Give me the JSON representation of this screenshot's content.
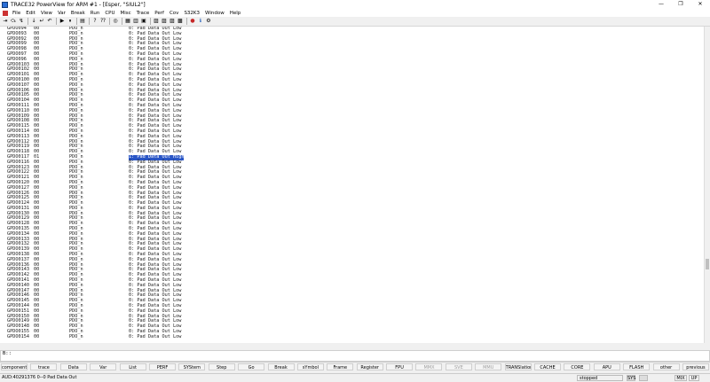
{
  "window": {
    "title": "TRACE32 PowerView for ARM #1 - [Esper, \"SIUL2\"]",
    "controls": [
      "—",
      "❐",
      "✕"
    ]
  },
  "menubar": {
    "items": [
      "File",
      "Edit",
      "View",
      "Var",
      "Break",
      "Run",
      "CPU",
      "Misc",
      "Trace",
      "Perf",
      "Cov",
      "S32K3",
      "Window",
      "Help"
    ]
  },
  "toolbar": {
    "icons": [
      {
        "name": "step-into-icon",
        "glyph": "⇥"
      },
      {
        "name": "step-over-icon",
        "glyph": "⤼"
      },
      {
        "name": "step-asm-icon",
        "glyph": "↯"
      },
      {
        "name": "sep"
      },
      {
        "name": "down-icon",
        "glyph": "↓"
      },
      {
        "name": "return-icon",
        "glyph": "↵"
      },
      {
        "name": "undo-icon",
        "glyph": "↶"
      },
      {
        "name": "sep"
      },
      {
        "name": "go-icon",
        "glyph": "▶"
      },
      {
        "name": "break-icon",
        "glyph": "⏸"
      },
      {
        "name": "sep"
      },
      {
        "name": "view-icon",
        "glyph": "▤"
      },
      {
        "name": "sep"
      },
      {
        "name": "help-icon",
        "glyph": "?"
      },
      {
        "name": "context-help-icon",
        "glyph": "⁇"
      },
      {
        "name": "sep"
      },
      {
        "name": "target-icon",
        "glyph": "◎"
      },
      {
        "name": "sep"
      },
      {
        "name": "list-icon",
        "glyph": "▦"
      },
      {
        "name": "dump-icon",
        "glyph": "▥"
      },
      {
        "name": "register-icon",
        "glyph": "▣"
      },
      {
        "name": "sep"
      },
      {
        "name": "chart-icon",
        "glyph": "▨"
      },
      {
        "name": "chart2-icon",
        "glyph": "▨"
      },
      {
        "name": "chart3-icon",
        "glyph": "▨"
      },
      {
        "name": "chart4-icon",
        "glyph": "▩"
      },
      {
        "name": "sep"
      },
      {
        "name": "record-icon",
        "glyph": "●"
      },
      {
        "name": "info-icon",
        "glyph": "ℹ"
      },
      {
        "name": "settings-icon",
        "glyph": "⚙"
      }
    ]
  },
  "rows": [
    {
      "name": "GPDO094",
      "val": "00",
      "field": "PDO_n",
      "desc": "0: Pad Data Out Low"
    },
    {
      "name": "GPDO093",
      "val": "00",
      "field": "PDO_n",
      "desc": "0: Pad Data Out Low"
    },
    {
      "name": "GPDO092",
      "val": "00",
      "field": "PDO_n",
      "desc": "0: Pad Data Out Low"
    },
    {
      "name": "GPDO099",
      "val": "00",
      "field": "PDO_n",
      "desc": "0: Pad Data Out Low"
    },
    {
      "name": "GPDO098",
      "val": "00",
      "field": "PDO_n",
      "desc": "0: Pad Data Out Low"
    },
    {
      "name": "GPDO097",
      "val": "00",
      "field": "PDO_n",
      "desc": "0: Pad Data Out Low"
    },
    {
      "name": "GPDO096",
      "val": "00",
      "field": "PDO_n",
      "desc": "0: Pad Data Out Low"
    },
    {
      "name": "GPDO0103",
      "val": "00",
      "field": "PDO_n",
      "desc": "0: Pad Data Out Low"
    },
    {
      "name": "GPDO0102",
      "val": "00",
      "field": "PDO_n",
      "desc": "0: Pad Data Out Low"
    },
    {
      "name": "GPDO0101",
      "val": "00",
      "field": "PDO_n",
      "desc": "0: Pad Data Out Low"
    },
    {
      "name": "GPDO0100",
      "val": "00",
      "field": "PDO_n",
      "desc": "0: Pad Data Out Low"
    },
    {
      "name": "GPDO0107",
      "val": "00",
      "field": "PDO_n",
      "desc": "0: Pad Data Out Low"
    },
    {
      "name": "GPDO0106",
      "val": "00",
      "field": "PDO_n",
      "desc": "0: Pad Data Out Low"
    },
    {
      "name": "GPDO0105",
      "val": "00",
      "field": "PDO_n",
      "desc": "0: Pad Data Out Low"
    },
    {
      "name": "GPDO0104",
      "val": "00",
      "field": "PDO_n",
      "desc": "0: Pad Data Out Low"
    },
    {
      "name": "GPDO0111",
      "val": "00",
      "field": "PDO_n",
      "desc": "0: Pad Data Out Low"
    },
    {
      "name": "GPDO0110",
      "val": "00",
      "field": "PDO_n",
      "desc": "0: Pad Data Out Low"
    },
    {
      "name": "GPDO0109",
      "val": "00",
      "field": "PDO_n",
      "desc": "0: Pad Data Out Low"
    },
    {
      "name": "GPDO0108",
      "val": "00",
      "field": "PDO_n",
      "desc": "0: Pad Data Out Low"
    },
    {
      "name": "GPDO0115",
      "val": "00",
      "field": "PDO_n",
      "desc": "0: Pad Data Out Low"
    },
    {
      "name": "GPDO0114",
      "val": "00",
      "field": "PDO_n",
      "desc": "0: Pad Data Out Low"
    },
    {
      "name": "GPDO0113",
      "val": "00",
      "field": "PDO_n",
      "desc": "0: Pad Data Out Low"
    },
    {
      "name": "GPDO0112",
      "val": "00",
      "field": "PDO_n",
      "desc": "0: Pad Data Out Low"
    },
    {
      "name": "GPDO0119",
      "val": "00",
      "field": "PDO_n",
      "desc": "0: Pad Data Out Low"
    },
    {
      "name": "GPDO0118",
      "val": "00",
      "field": "PDO_n",
      "desc": "0: Pad Data Out Low"
    },
    {
      "name": "GPDO0117",
      "val": "01",
      "field": "PDO_n",
      "desc": "1: Pad Data Out High",
      "selected": true
    },
    {
      "name": "GPDO0116",
      "val": "00",
      "field": "PDO_n",
      "desc": "0: Pad Data Out Low"
    },
    {
      "name": "GPDO0123",
      "val": "00",
      "field": "PDO_n",
      "desc": "0: Pad Data Out Low"
    },
    {
      "name": "GPDO0122",
      "val": "00",
      "field": "PDO_n",
      "desc": "0: Pad Data Out Low"
    },
    {
      "name": "GPDO0121",
      "val": "00",
      "field": "PDO_n",
      "desc": "0: Pad Data Out Low"
    },
    {
      "name": "GPDO0120",
      "val": "00",
      "field": "PDO_n",
      "desc": "0: Pad Data Out Low"
    },
    {
      "name": "GPDO0127",
      "val": "00",
      "field": "PDO_n",
      "desc": "0: Pad Data Out Low"
    },
    {
      "name": "GPDO0126",
      "val": "00",
      "field": "PDO_n",
      "desc": "0: Pad Data Out Low"
    },
    {
      "name": "GPDO0125",
      "val": "00",
      "field": "PDO_n",
      "desc": "0: Pad Data Out Low"
    },
    {
      "name": "GPDO0124",
      "val": "00",
      "field": "PDO_n",
      "desc": "0: Pad Data Out Low"
    },
    {
      "name": "GPDO0131",
      "val": "00",
      "field": "PDO_n",
      "desc": "0: Pad Data Out Low"
    },
    {
      "name": "GPDO0130",
      "val": "00",
      "field": "PDO_n",
      "desc": "0: Pad Data Out Low"
    },
    {
      "name": "GPDO0129",
      "val": "00",
      "field": "PDO_n",
      "desc": "0: Pad Data Out Low"
    },
    {
      "name": "GPDO0128",
      "val": "00",
      "field": "PDO_n",
      "desc": "0: Pad Data Out Low"
    },
    {
      "name": "GPDO0135",
      "val": "00",
      "field": "PDO_n",
      "desc": "0: Pad Data Out Low"
    },
    {
      "name": "GPDO0134",
      "val": "00",
      "field": "PDO_n",
      "desc": "0: Pad Data Out Low"
    },
    {
      "name": "GPDO0133",
      "val": "00",
      "field": "PDO_n",
      "desc": "0: Pad Data Out Low"
    },
    {
      "name": "GPDO0132",
      "val": "00",
      "field": "PDO_n",
      "desc": "0: Pad Data Out Low"
    },
    {
      "name": "GPDO0139",
      "val": "00",
      "field": "PDO_n",
      "desc": "0: Pad Data Out Low"
    },
    {
      "name": "GPDO0138",
      "val": "00",
      "field": "PDO_n",
      "desc": "0: Pad Data Out Low"
    },
    {
      "name": "GPDO0137",
      "val": "00",
      "field": "PDO_n",
      "desc": "0: Pad Data Out Low"
    },
    {
      "name": "GPDO0136",
      "val": "00",
      "field": "PDO_n",
      "desc": "0: Pad Data Out Low"
    },
    {
      "name": "GPDO0143",
      "val": "00",
      "field": "PDO_n",
      "desc": "0: Pad Data Out Low"
    },
    {
      "name": "GPDO0142",
      "val": "00",
      "field": "PDO_n",
      "desc": "0: Pad Data Out Low"
    },
    {
      "name": "GPDO0141",
      "val": "00",
      "field": "PDO_n",
      "desc": "0: Pad Data Out Low"
    },
    {
      "name": "GPDO0140",
      "val": "00",
      "field": "PDO_n",
      "desc": "0: Pad Data Out Low"
    },
    {
      "name": "GPDO0147",
      "val": "00",
      "field": "PDO_n",
      "desc": "0: Pad Data Out Low"
    },
    {
      "name": "GPDO0146",
      "val": "00",
      "field": "PDO_n",
      "desc": "0: Pad Data Out Low"
    },
    {
      "name": "GPDO0145",
      "val": "00",
      "field": "PDO_n",
      "desc": "0: Pad Data Out Low"
    },
    {
      "name": "GPDO0144",
      "val": "00",
      "field": "PDO_n",
      "desc": "0: Pad Data Out Low"
    },
    {
      "name": "GPDO0151",
      "val": "00",
      "field": "PDO_n",
      "desc": "0: Pad Data Out Low"
    },
    {
      "name": "GPDO0150",
      "val": "00",
      "field": "PDO_n",
      "desc": "0: Pad Data Out Low"
    },
    {
      "name": "GPDO0149",
      "val": "00",
      "field": "PDO_n",
      "desc": "0: Pad Data Out Low"
    },
    {
      "name": "GPDO0148",
      "val": "00",
      "field": "PDO_n",
      "desc": "0: Pad Data Out Low"
    },
    {
      "name": "GPDO0155",
      "val": "00",
      "field": "PDO_n",
      "desc": "0: Pad Data Out Low"
    },
    {
      "name": "GPDO0154",
      "val": "00",
      "field": "PDO_n",
      "desc": "0: Pad Data Out Low"
    }
  ],
  "command": {
    "prompt": "B::"
  },
  "softkeys": [
    {
      "label": "components",
      "enabled": true
    },
    {
      "label": "trace",
      "enabled": true
    },
    {
      "label": "Data",
      "enabled": true
    },
    {
      "label": "Var",
      "enabled": true
    },
    {
      "label": "List",
      "enabled": true
    },
    {
      "label": "PERF",
      "enabled": true
    },
    {
      "label": "SYStem",
      "enabled": true
    },
    {
      "label": "Step",
      "enabled": true
    },
    {
      "label": "Go",
      "enabled": true
    },
    {
      "label": "Break",
      "enabled": true
    },
    {
      "label": "sYmbol",
      "enabled": true
    },
    {
      "label": "Frame",
      "enabled": true
    },
    {
      "label": "Register",
      "enabled": true
    },
    {
      "label": "FPU",
      "enabled": true
    },
    {
      "label": "MMX",
      "enabled": false
    },
    {
      "label": "SVE",
      "enabled": false
    },
    {
      "label": "MMU",
      "enabled": false
    },
    {
      "label": "TRANSlation",
      "enabled": true
    },
    {
      "label": "CACHE",
      "enabled": true
    },
    {
      "label": "CORE",
      "enabled": true
    },
    {
      "label": "APU",
      "enabled": true
    },
    {
      "label": "FLASH",
      "enabled": true
    },
    {
      "label": "other",
      "enabled": true
    },
    {
      "label": "previous",
      "enabled": true
    }
  ],
  "status": {
    "address": "AUD:40291376  0--0  Pad Data Out",
    "state": "stopped",
    "cells": [
      "SYS",
      "",
      "MIX",
      "UP"
    ]
  }
}
